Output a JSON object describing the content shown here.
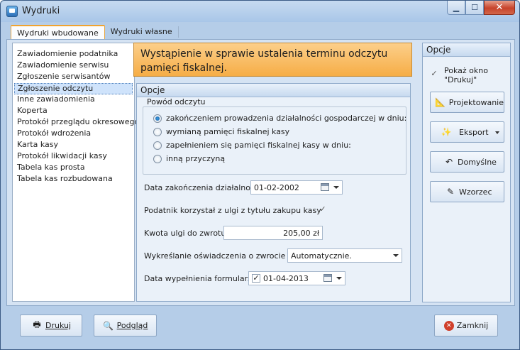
{
  "window": {
    "title": "Wydruki"
  },
  "tabs": [
    "Wydruki wbudowane",
    "Wydruki własne"
  ],
  "list": {
    "items": [
      "Zawiadomienie podatnika",
      "Zawiadomienie serwisu",
      "Zgłoszenie serwisantów",
      "Zgłoszenie odczytu",
      "Inne zawiadomienia",
      "Koperta",
      "Protokół przeglądu okresowego",
      "Protokół wdrożenia",
      "Karta kasy",
      "Protokół likwidacji kasy",
      "Tabela kas prosta",
      "Tabela kas rozbudowana"
    ],
    "selected": "Zgłoszenie odczytu"
  },
  "header": {
    "title": "Wystąpienie w sprawie ustalenia terminu odczytu pamięci fiskalnej."
  },
  "options": {
    "title": "Opcje",
    "reason": {
      "legend": "Powód odczytu",
      "options": [
        "zakończeniem prowadzenia działalności gospodarczej w dniu:",
        "wymianą pamięci fiskalnej kasy",
        "zapełnieniem się pamięci fiskalnej kasy w dniu:",
        "inną przyczyną"
      ],
      "selected": "zakończeniem prowadzenia działalności gospodarczej w dniu:"
    },
    "end_date": {
      "label": "Data zakończenia działalności:",
      "value": "01-02-2002"
    },
    "relief": {
      "label": "Podatnik korzystał z ulgi z tytułu zakupu kasy",
      "checked": "✓"
    },
    "relief_amount": {
      "label": "Kwota ulgi do zwrotu:",
      "value": "205,00 zł"
    },
    "strike": {
      "label": "Wykreślanie oświadczenia o zwrocie ulgi:",
      "value": "Automatycznie."
    },
    "fill_date": {
      "label": "Data wypełnienia formularza:",
      "value": "01-04-2013",
      "checked": "✓"
    }
  },
  "side": {
    "title": "Opcje",
    "show_dialog": {
      "label": "Pokaż okno \"Drukuj\"",
      "checked": "✓"
    },
    "buttons": [
      "Projektowanie",
      "Eksport",
      "Domyślne",
      "Wzorzec"
    ]
  },
  "footer": {
    "print": "Drukuj",
    "preview": "Podgląd",
    "close": "Zamknij"
  },
  "colors": {
    "accent": "#f6ad46",
    "window_bg": "#b5cde8",
    "close": "#c7432b"
  }
}
